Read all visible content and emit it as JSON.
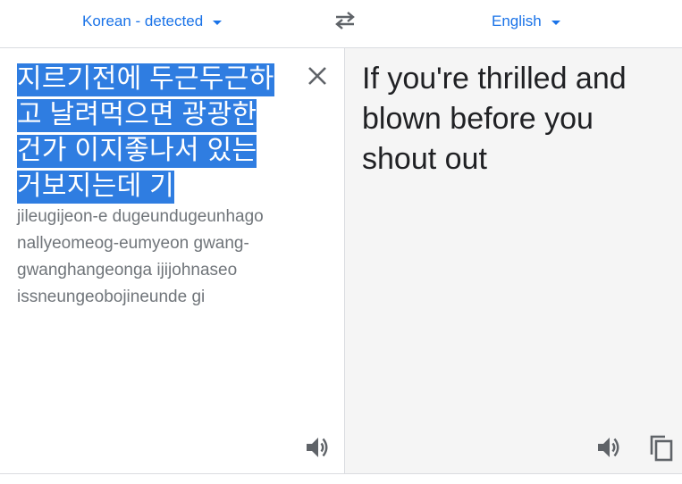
{
  "header": {
    "source_language": "Korean - detected",
    "target_language": "English"
  },
  "source": {
    "text": "지르기전에 두근두근하고 날려먹으면 광광한건가 이지좋나서 있는거보지는데 기",
    "romanization": "jileugijeon-e dugeundugeunhago nallyeomeog-eumyeon gwang-gwanghangeonga ijijohnaseo issneungeobojineunde gi"
  },
  "target": {
    "text": "If you're thrilled and blown before you shout out"
  },
  "icons": {
    "swap": "swap-arrows-icon",
    "clear": "close-icon",
    "speak": "volume-icon",
    "copy": "copy-icon"
  },
  "colors": {
    "accent": "#1a73e8",
    "selection": "#2f7de1",
    "icon": "#5f6368"
  }
}
